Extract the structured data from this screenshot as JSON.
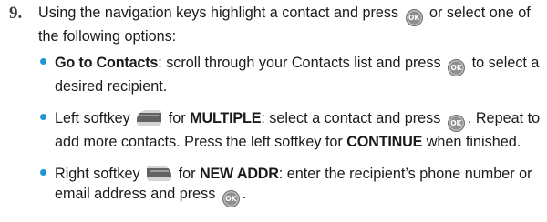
{
  "step": {
    "number": "9.",
    "intro_before_icon": "Using the navigation keys highlight a contact and press ",
    "intro_after_icon": " or select one of the following options:"
  },
  "ok_icon_glyph": "OK",
  "bullet_color": "#2196d3",
  "bullets": [
    {
      "bold": "Go to Contacts",
      "text_before_icon": ": scroll through your Contacts list and press ",
      "text_after_icon": " to select a desired recipient."
    },
    {
      "lead": "Left softkey ",
      "key_icon": "left-softkey-icon",
      "for_text": " for ",
      "bold": "MULTIPLE",
      "text_before_icon": ": select a contact and press ",
      "text_after_icon": ". Repeat to add more contacts. Press the left softkey for ",
      "bold2": "CONTINUE",
      "tail": " when finished."
    },
    {
      "lead": "Right softkey ",
      "key_icon": "right-softkey-icon",
      "for_text": " for ",
      "bold": "NEW ADDR",
      "text_before_icon": ": enter the recipient’s phone number or email address and press ",
      "text_after_icon": "."
    }
  ]
}
